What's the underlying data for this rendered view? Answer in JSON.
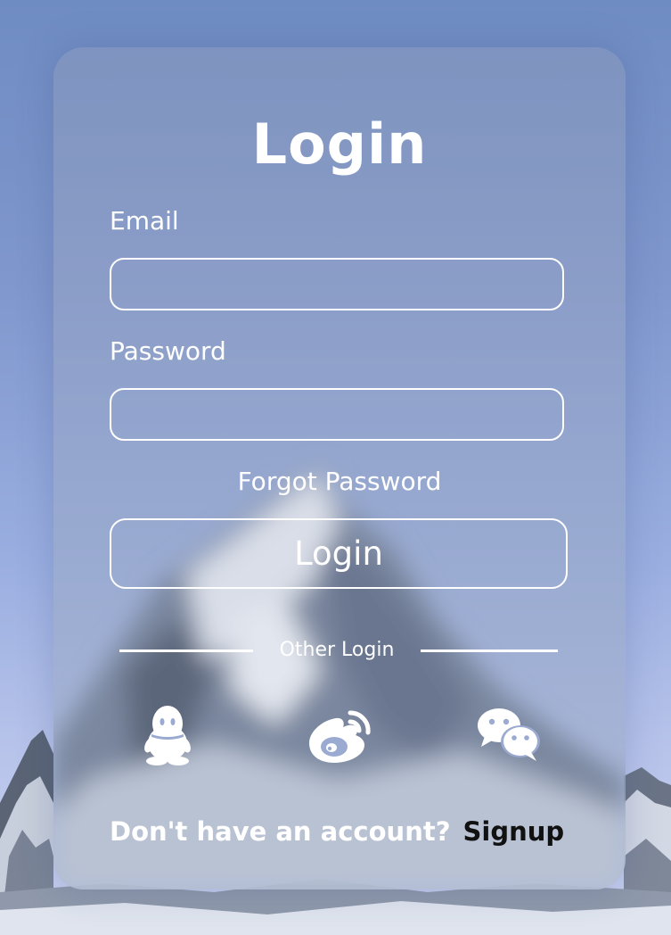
{
  "colors": {
    "text": "#ffffff",
    "signup_link": "#111111",
    "sky": "#7f97cd"
  },
  "login": {
    "title": "Login",
    "email_label": "Email",
    "email_value": "",
    "password_label": "Password",
    "password_value": "",
    "forgot_password": "Forgot Password",
    "login_button": "Login",
    "other_login": "Other Login",
    "social_icons": [
      "qq-icon",
      "weibo-icon",
      "wechat-icon"
    ],
    "no_account": "Don't have an account?",
    "signup": "Signup"
  }
}
